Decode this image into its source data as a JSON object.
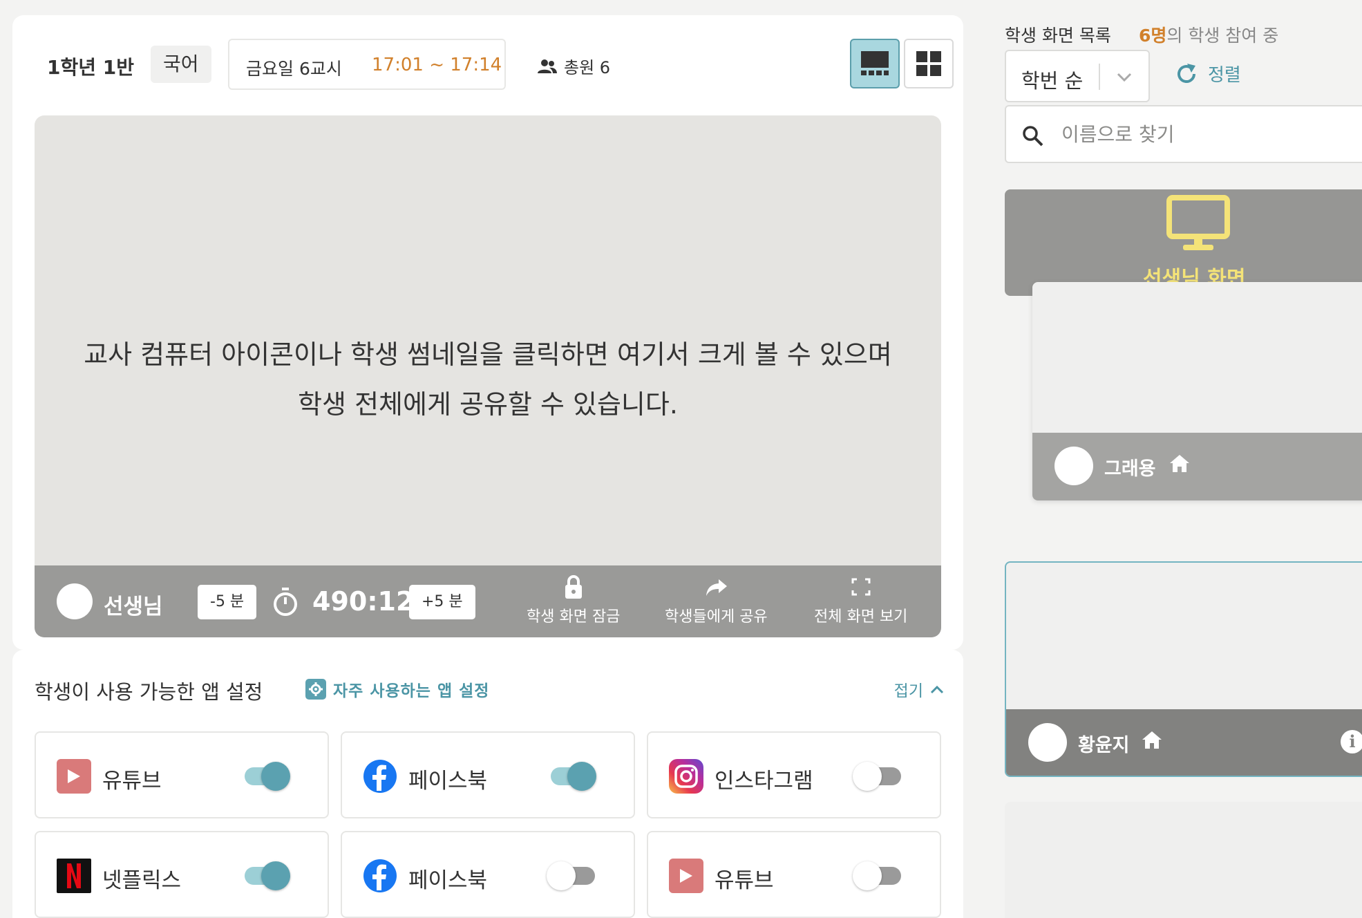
{
  "header": {
    "class_name": "1학년 1반",
    "subject": "국어",
    "period_label": "금요일 6교시",
    "period_time": "17:01 ~ 17:14",
    "members_label": "총원 6"
  },
  "viewer": {
    "message_line1": "교사 컴퓨터 아이콘이나 학생 썸네일을 클릭하면 여기서 크게 볼 수 있으며",
    "message_line2": "학생 전체에게 공유할 수 있습니다.",
    "presenter_name": "선생님",
    "minus_label": "-5 분",
    "plus_label": "+5 분",
    "timer": "490:12",
    "actions": {
      "lock": "학생 화면 잠금",
      "share": "학생들에게 공유",
      "fullscreen": "전체 화면 보기"
    }
  },
  "apps": {
    "title": "학생이 사용 가능한 앱 설정",
    "frequent_link": "자주 사용하는 앱 설정",
    "fold_label": "접기",
    "items": [
      {
        "name": "유튜브",
        "icon": "youtube-icon",
        "enabled": true
      },
      {
        "name": "페이스북",
        "icon": "facebook-icon",
        "enabled": true
      },
      {
        "name": "인스타그램",
        "icon": "instagram-icon",
        "enabled": false
      },
      {
        "name": "넷플릭스",
        "icon": "netflix-icon",
        "enabled": true
      },
      {
        "name": "페이스북",
        "icon": "facebook-icon",
        "enabled": false
      },
      {
        "name": "유튜브",
        "icon": "youtube-icon",
        "enabled": false
      }
    ]
  },
  "right": {
    "title": "학생 화면 목록",
    "count_number": "6명",
    "count_suffix": "의 학생 참여 중",
    "sort_value": "학번 순",
    "sort_button": "정렬",
    "search_placeholder": "이름으로 찾기",
    "teacher_screen_label": "선생님 화면",
    "students": [
      {
        "name": "그래용"
      },
      {
        "name": "황윤지"
      }
    ]
  },
  "colors": {
    "accent": "#5ba1b0",
    "orange": "#d1802b",
    "teacher_label": "#f4e378",
    "youtube": "#d97a7a",
    "facebook": "#1877f2",
    "netflix_bg": "#111111",
    "netflix_fg": "#e50914"
  }
}
